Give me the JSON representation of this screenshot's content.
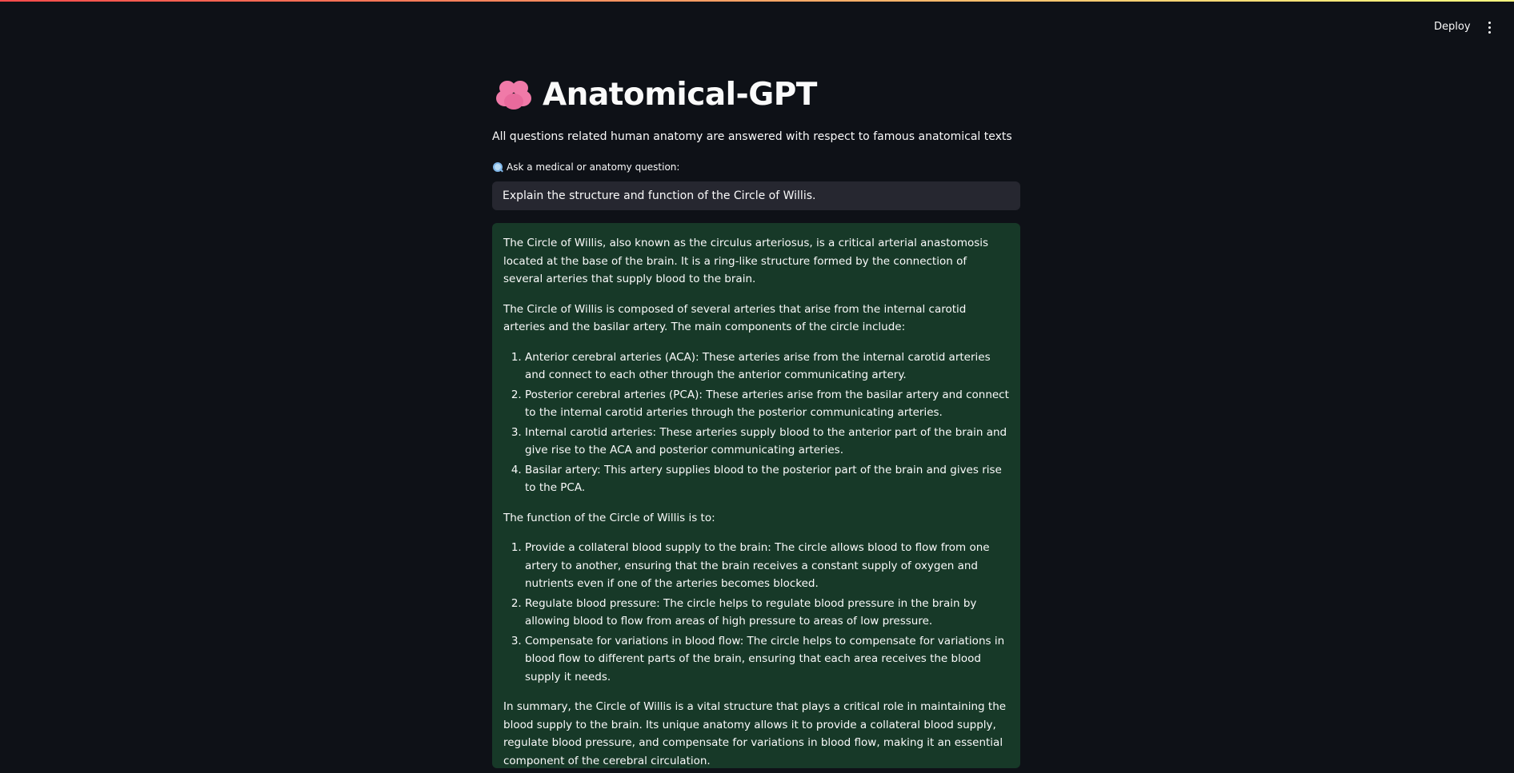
{
  "header": {
    "deploy_label": "Deploy",
    "menu_icon": "vertical-ellipsis-icon"
  },
  "main": {
    "title_icon": "brain-icon",
    "title": "Anatomical-GPT",
    "subtitle": "All questions related human anatomy are answered with respect to famous anatomical texts",
    "input_label_icon": "magnifying-glass-icon",
    "input_label": "Ask a medical or anatomy question:",
    "input_value": "Explain the structure and function of the Circle of Willis."
  },
  "answer": {
    "p1": "The Circle of Willis, also known as the circulus arteriosus, is a critical arterial anastomosis located at the base of the brain. It is a ring-like structure formed by the connection of several arteries that supply blood to the brain.",
    "p2": "The Circle of Willis is composed of several arteries that arise from the internal carotid arteries and the basilar artery. The main components of the circle include:",
    "components": [
      "Anterior cerebral arteries (ACA): These arteries arise from the internal carotid arteries and connect to each other through the anterior communicating artery.",
      "Posterior cerebral arteries (PCA): These arteries arise from the basilar artery and connect to the internal carotid arteries through the posterior communicating arteries.",
      "Internal carotid arteries: These arteries supply blood to the anterior part of the brain and give rise to the ACA and posterior communicating arteries.",
      "Basilar artery: This artery supplies blood to the posterior part of the brain and gives rise to the PCA."
    ],
    "p3": "The function of the Circle of Willis is to:",
    "functions": [
      "Provide a collateral blood supply to the brain: The circle allows blood to flow from one artery to another, ensuring that the brain receives a constant supply of oxygen and nutrients even if one of the arteries becomes blocked.",
      "Regulate blood pressure: The circle helps to regulate blood pressure in the brain by allowing blood to flow from areas of high pressure to areas of low pressure.",
      "Compensate for variations in blood flow: The circle helps to compensate for variations in blood flow to different parts of the brain, ensuring that each area receives the blood supply it needs."
    ],
    "p4": "In summary, the Circle of Willis is a vital structure that plays a critical role in maintaining the blood supply to the brain. Its unique anatomy allows it to provide a collateral blood supply, regulate blood pressure, and compensate for variations in blood flow, making it an essential component of the cerebral circulation."
  },
  "colors": {
    "background": "#0e1117",
    "input_bg": "#262730",
    "answer_bg": "#173928",
    "text": "#fafafa"
  }
}
